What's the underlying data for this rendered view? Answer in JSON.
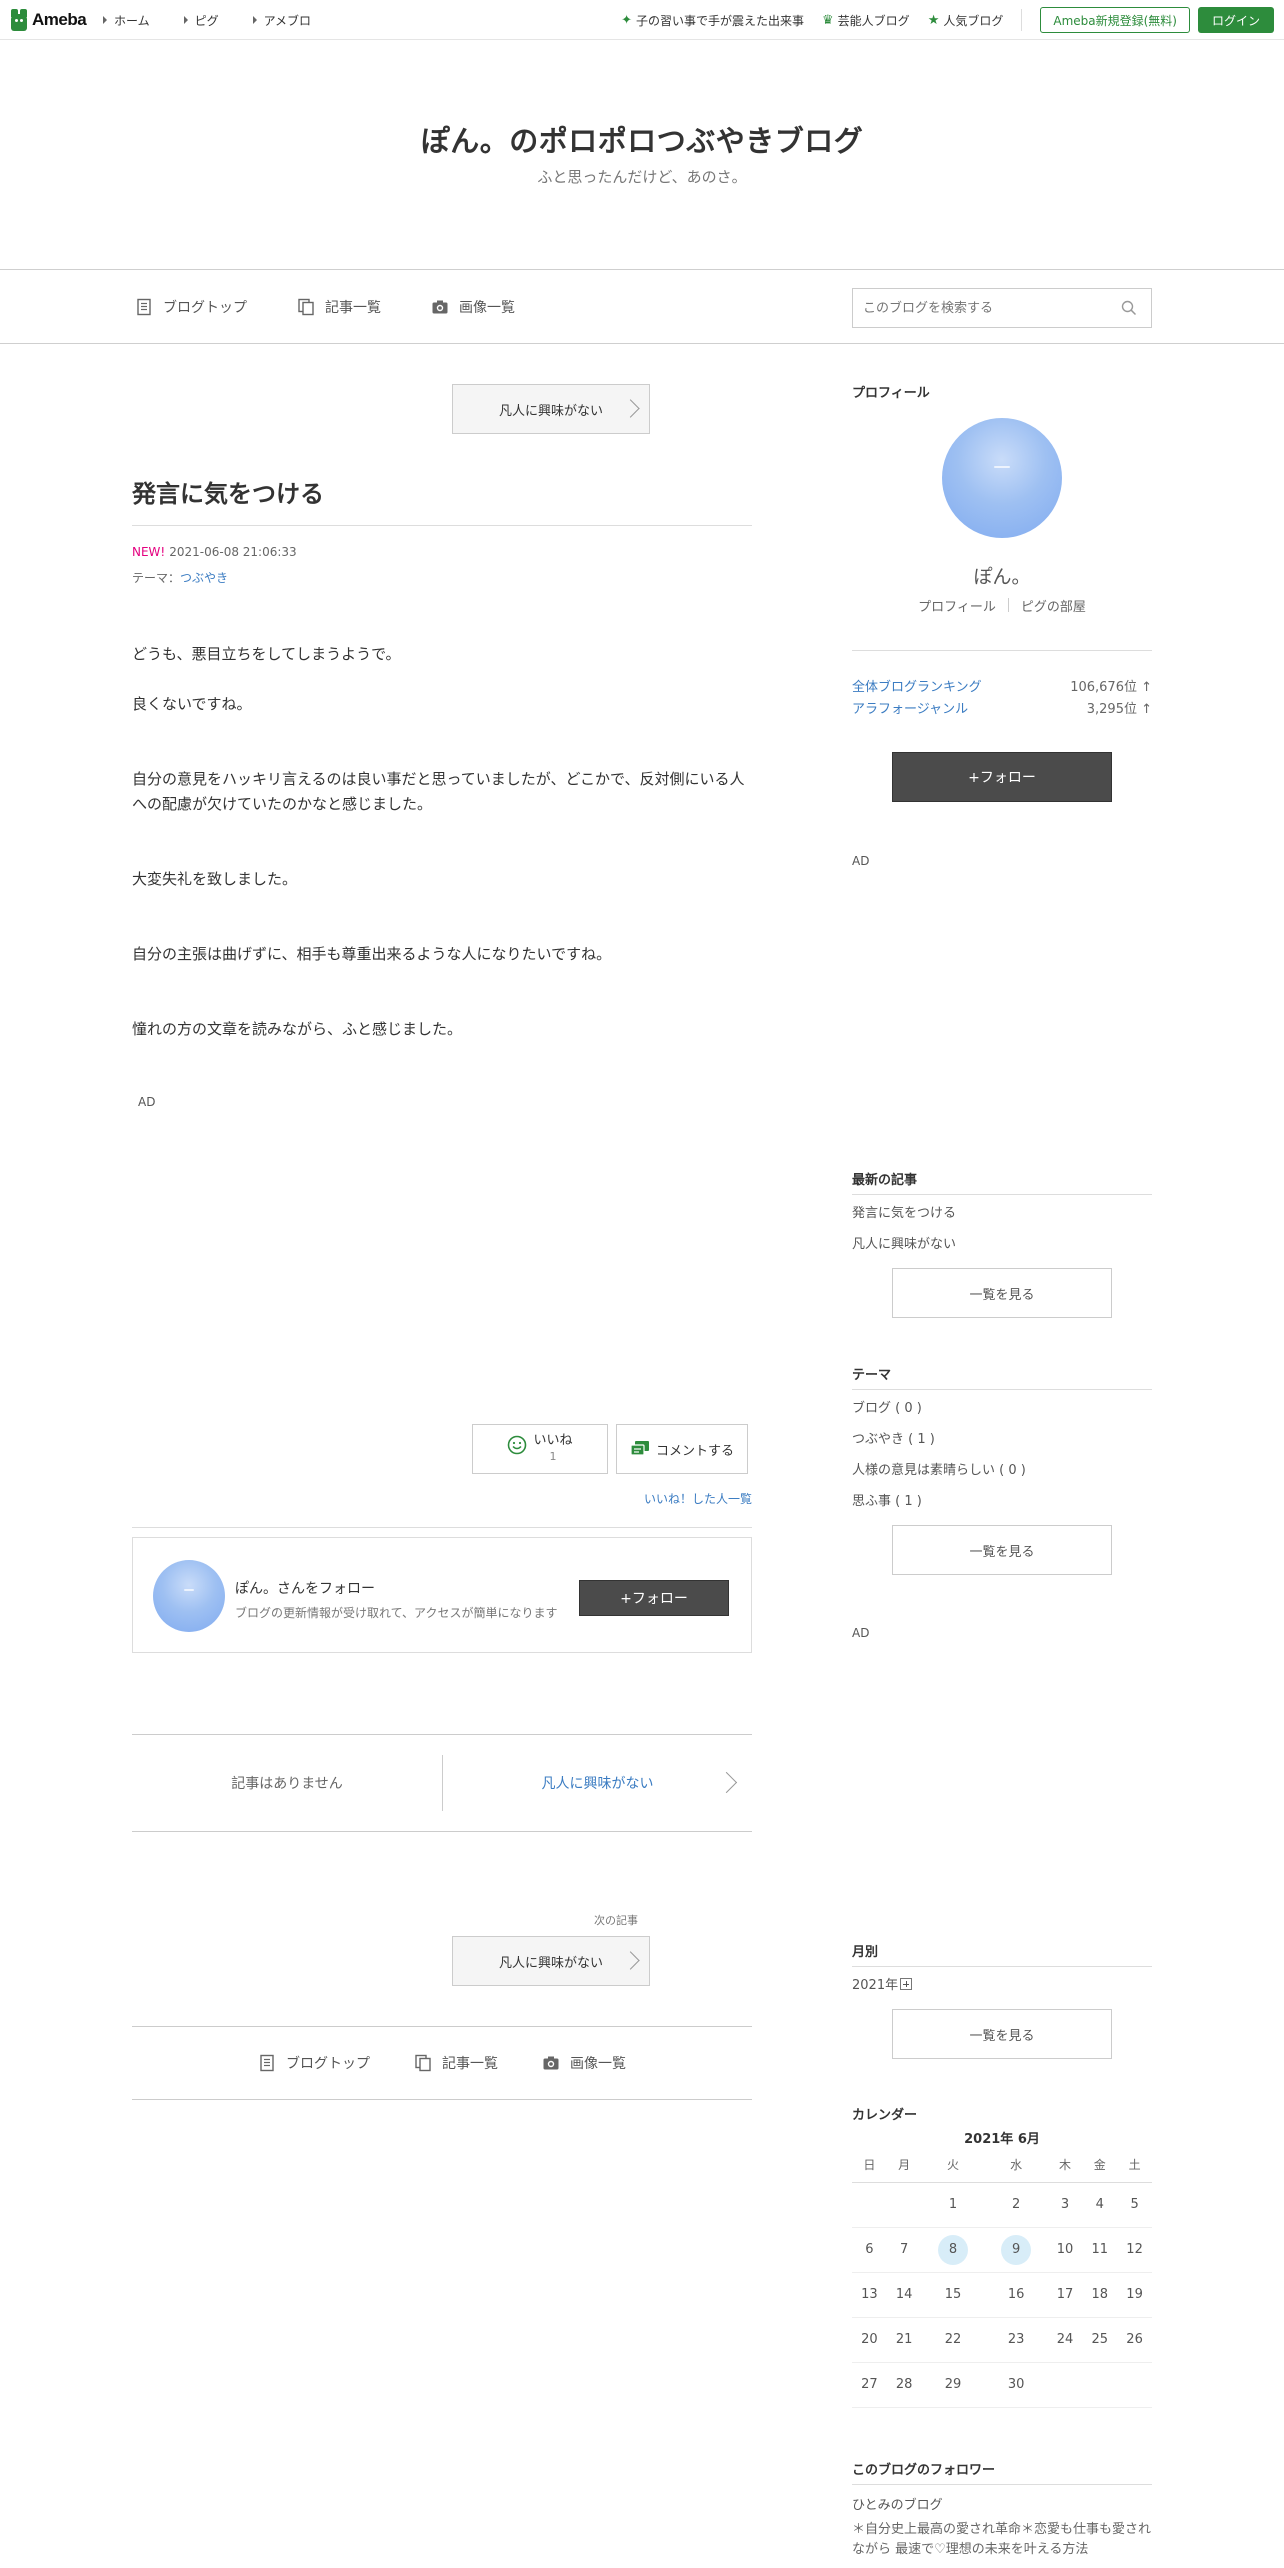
{
  "topbar": {
    "logo_text": "Ameba",
    "nav": [
      "ホーム",
      "ピグ",
      "アメブロ"
    ],
    "links": [
      "子の習い事で手が震えた出来事",
      "芸能人ブログ",
      "人気ブログ"
    ],
    "register_label": "Ameba新規登録(無料)",
    "login_label": "ログイン",
    "accent_color": "#2d8c3c"
  },
  "header": {
    "title": "ぽん。のポロポロつぶやきブログ",
    "description": "ふと思ったんだけど、あのさ。"
  },
  "global_nav": {
    "items": [
      "ブログトップ",
      "記事一覧",
      "画像一覧"
    ],
    "search_placeholder": "このブログを検索する"
  },
  "entry": {
    "prev_link": "凡人に興味がない",
    "title": "発言に気をつける",
    "new_badge": "NEW!",
    "datetime": "2021-06-08 21:06:33",
    "theme_label": "テーマ：",
    "theme": "つぶやき",
    "paragraphs": [
      "どうも、悪目立ちをしてしまうようで。",
      "良くないですね。",
      "自分の意見をハッキリ言えるのは良い事だと思っていましたが、どこかで、反対側にいる人への配慮が欠けていたのかなと感じました。",
      "大変失礼を致しました。",
      "自分の主張は曲げずに、相手も尊重出来るような人になりたいですね。",
      "憧れの方の文章を読みながら、ふと感じました。"
    ],
    "ad_label": "AD",
    "iine_label": "いいね",
    "iine_count": "1",
    "comment_label": "コメントする",
    "iine_list_label": "いいね！した人一覧"
  },
  "follow_box": {
    "name": "ぽん。さんをフォロー",
    "description": "ブログの更新情報が受け取れて、アクセスが簡単になります",
    "button": "+フォロー"
  },
  "pager": {
    "prev": "記事はありません",
    "next": "凡人に興味がない",
    "next_label": "次の記事",
    "next_button": "凡人に興味がない"
  },
  "footer_nav": {
    "items": [
      "ブログトップ",
      "記事一覧",
      "画像一覧"
    ]
  },
  "sidebar": {
    "profile_heading": "プロフィール",
    "profile_name": "ぽん。",
    "profile_link": "プロフィール",
    "pig_link": "ピグの部屋",
    "ranking": [
      {
        "label": "全体ブログランキング",
        "value": "106,676位 ↑"
      },
      {
        "label": "アラフォージャンル",
        "value": "3,295位 ↑"
      }
    ],
    "follow_button": "+フォロー",
    "ad_label": "AD",
    "latest_heading": "最新の記事",
    "latest": [
      "発言に気をつける",
      "凡人に興味がない"
    ],
    "more_label": "一覧を見る",
    "theme_heading": "テーマ",
    "themes": [
      "ブログ ( 0 )",
      "つぶやき ( 1 )",
      "人様の意見は素晴らしい ( 0 )",
      "思ふ事 ( 1 )"
    ],
    "monthly_heading": "月別",
    "monthly_year": "2021年",
    "calendar_heading": "カレンダー",
    "calendar_title": "2021年 6月",
    "weekdays": [
      "日",
      "月",
      "火",
      "水",
      "木",
      "金",
      "土"
    ],
    "weeks": [
      [
        "",
        "",
        "1",
        "2",
        "3",
        "4",
        "5"
      ],
      [
        "6",
        "7",
        "8",
        "9",
        "10",
        "11",
        "12"
      ],
      [
        "13",
        "14",
        "15",
        "16",
        "17",
        "18",
        "19"
      ],
      [
        "20",
        "21",
        "22",
        "23",
        "24",
        "25",
        "26"
      ],
      [
        "27",
        "28",
        "29",
        "30",
        "",
        "",
        ""
      ]
    ],
    "highlight_days": [
      "8",
      "9"
    ],
    "followers_heading": "このブログのフォロワー",
    "follower_name": "ひとみのブログ",
    "follower_desc": "＊自分史上最高の愛され革命＊恋愛も仕事も愛されながら 最速で♡理想の未来を叶える方法"
  }
}
